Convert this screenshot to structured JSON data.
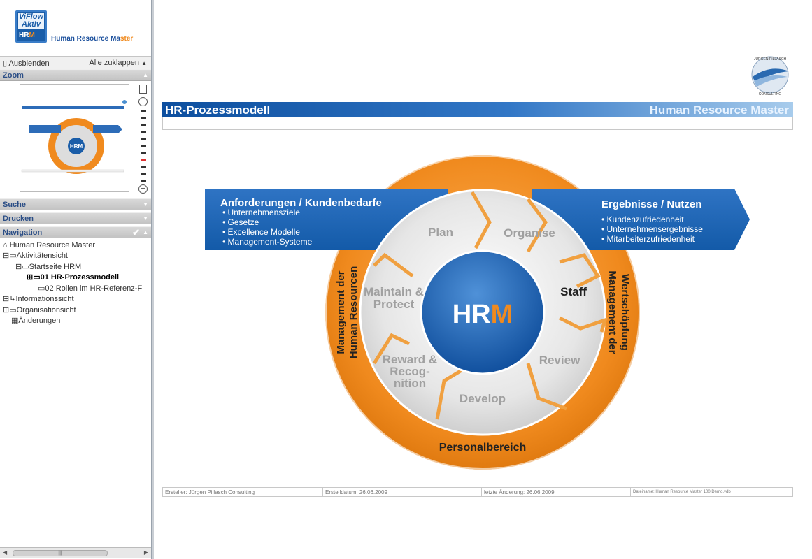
{
  "sidebar": {
    "logo_top": "ViFlow Aktiv",
    "logo_hrm": "HR",
    "logo_hrm_m": "M",
    "app_name_a": "Human Resource Ma",
    "app_name_b": "ster",
    "hide_label": "Ausblenden",
    "collapse_all": "Alle zuklappen",
    "sections": {
      "zoom": "Zoom",
      "search": "Suche",
      "print": "Drucken",
      "navigation": "Navigation"
    },
    "tree": [
      {
        "label": "Human Resource Master"
      },
      {
        "label": "Aktivitätensicht"
      },
      {
        "label": "Startseite HRM"
      },
      {
        "label": "01 HR-Prozessmodell"
      },
      {
        "label": "02 Rollen im HR-Referenz-F"
      },
      {
        "label": "Informationssicht"
      },
      {
        "label": "Organisationsicht"
      },
      {
        "label": "Änderungen"
      }
    ]
  },
  "page": {
    "title": "HR-Prozessmodell",
    "subtitle": "Human Resource Master",
    "logo_text_top": "JÜRGEN PILLASCH",
    "logo_text_bottom": "CONSULTING",
    "left_arrow_title": "Anforderungen / Kundenbedarfe",
    "left_arrow_items": [
      "Unternehmensziele",
      "Gesetze",
      "Excellence Modelle",
      "Management-Systeme"
    ],
    "right_arrow_title": "Ergebnisse / Nutzen",
    "right_arrow_items": [
      "Kundenzufriedenheit",
      "Unternehmensergebnisse",
      "Mitarbeiterzufriedenheit"
    ],
    "ring_left_1": "Management der",
    "ring_left_2": "Human Resourcen",
    "ring_right_1": "Management der",
    "ring_right_2": "Wertschöpfung",
    "ring_bottom": "Personalbereich",
    "center_a": "HR",
    "center_b": "M",
    "segments": {
      "plan": "Plan",
      "organise": "Organise",
      "staff": "Staff",
      "review": "Review",
      "develop": "Develop",
      "reward_1": "Reward &",
      "reward_2": "Recog-",
      "reward_3": "nition",
      "maintain_1": "Maintain &",
      "maintain_2": "Protect"
    },
    "footer": {
      "author": "Ersteller: Jürgen Pillasch Consulting",
      "created": "Erstelldatum: 26.06.2009",
      "changed": "letzte Änderung: 26.06.2009",
      "file": "Dateiname: Human Resource Master 100 Demo.vdb"
    }
  },
  "colors": {
    "orange": "#f08a1e",
    "blue": "#1a5da8",
    "nav_blue": "#2b4e86"
  }
}
